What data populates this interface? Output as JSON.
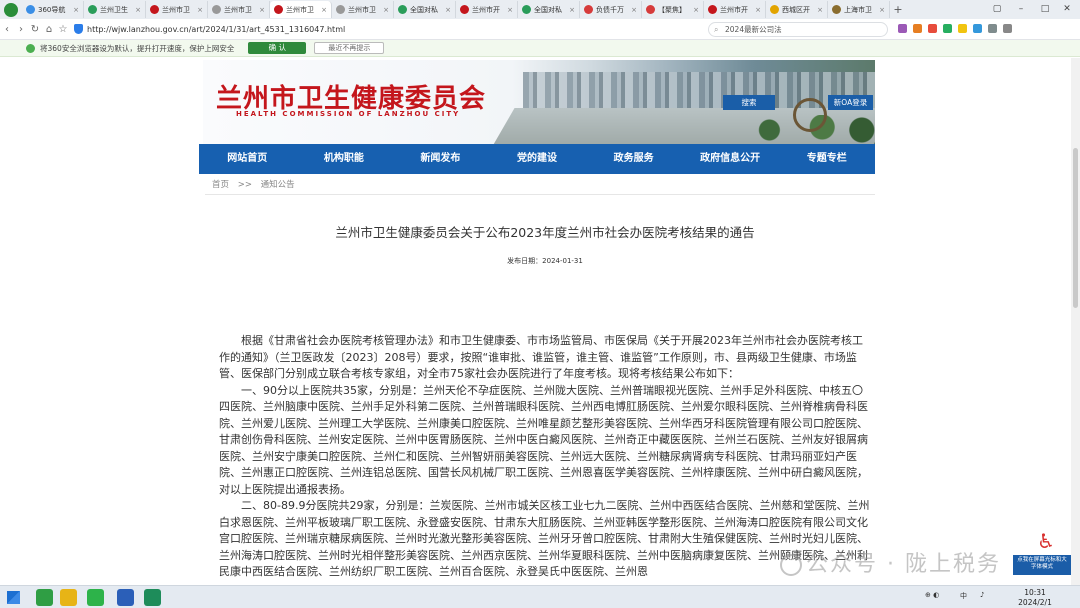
{
  "browser": {
    "tabs": [
      {
        "label": "360导航",
        "fav": "#3a8ee6"
      },
      {
        "label": "兰州卫生",
        "fav": "#2a9d5a"
      },
      {
        "label": "兰州市卫",
        "fav": "#c4161c"
      },
      {
        "label": "兰州市卫",
        "fav": "#999999"
      },
      {
        "label": "兰州市卫",
        "fav": "#c4161c",
        "active": true
      },
      {
        "label": "兰州市卫",
        "fav": "#999999"
      },
      {
        "label": "全国对私",
        "fav": "#2a9d5a"
      },
      {
        "label": "兰州市开",
        "fav": "#c4161c"
      },
      {
        "label": "全国对私",
        "fav": "#2a9d5a"
      },
      {
        "label": "负债千万",
        "fav": "#d63b3b"
      },
      {
        "label": "【聚焦】",
        "fav": "#d63b3b"
      },
      {
        "label": "兰州市开",
        "fav": "#c4161c"
      },
      {
        "label": "西城区开",
        "fav": "#e2a400"
      },
      {
        "label": "上海市卫",
        "fav": "#8a6d2f"
      }
    ],
    "url": "http://wjw.lanzhou.gov.cn/art/2024/1/31/art_4531_1316047.html",
    "search_text": "2024最新公司法",
    "notice": {
      "text": "将360安全浏览器设为默认，提升打开速度，保护上网安全",
      "ok_label": "确 认",
      "later_label": "最近不再提示"
    }
  },
  "site": {
    "title": "兰州市卫生健康委员会",
    "subtitle": "HEALTH COMMISSION OF LANZHOU CITY",
    "search_label": "搜索",
    "oa_label": "新OA登录",
    "nav": [
      "网站首页",
      "机构职能",
      "新闻发布",
      "党的建设",
      "政务服务",
      "政府信息公开",
      "专题专栏"
    ]
  },
  "breadcrumb": {
    "home": "首页",
    "sep": ">>",
    "current": "通知公告"
  },
  "article": {
    "title": "兰州市卫生健康委员会关于公布2023年度兰州市社会办医院考核结果的通告",
    "date_label": "发布日期：",
    "date": "2024-01-31",
    "paragraphs": [
      "根据《甘肃省社会办医院考核管理办法》和市卫生健康委、市市场监管局、市医保局《关于开展2023年兰州市社会办医院考核工作的通知》（兰卫医政发〔2023〕208号）要求，按照“谁审批、谁监管，谁主管、谁监管”工作原则，市、县两级卫生健康、市场监管、医保部门分别成立联合考核专家组，对全市75家社会办医院进行了年度考核。现将考核结果公布如下：",
      "一、90分以上医院共35家，分别是：兰州天伦不孕症医院、兰州陇大医院、兰州普瑞眼视光医院、兰州手足外科医院、中核五〇四医院、兰州脑康中医院、兰州手足外科第二医院、兰州普瑞眼科医院、兰州西电博肛肠医院、兰州爱尔眼科医院、兰州脊椎病骨科医院、兰州爱儿医院、兰州理工大学医院、兰州康美口腔医院、兰州唯星颜艺整形美容医院、兰州华西牙科医院管理有限公司口腔医院、甘肃创伤骨科医院、兰州安定医院、兰州中医胃肠医院、兰州中医白癜风医院、兰州奇正中藏医医院、兰州兰石医院、兰州友好银屑病医院、兰州安宁康美口腔医院、兰州仁和医院、兰州智妍丽美容医院、兰州远大医院、兰州糖尿病肾病专科医院、甘肃玛丽亚妇产医院、兰州惠正口腔医院、兰州连铝总医院、国营长风机械厂职工医院、兰州恩喜医学美容医院、兰州梓康医院、兰州中研白癜风医院，对以上医院提出通报表扬。",
      "二、80-89.9分医院共29家，分别是：兰炭医院、兰州市城关区核工业七九二医院、兰州中西医结合医院、兰州慈和堂医院、兰州白求恩医院、兰州平板玻璃厂职工医院、永登盛安医院、甘肃东大肛肠医院、兰州亚韩医学整形医院、兰州海涛口腔医院有限公司文化宫口腔医院、兰州瑞京糖尿病医院、兰州时光激光整形美容医院、兰州牙牙曾口腔医院、甘肃附大生殖保健医院、兰州时光妇儿医院、兰州海涛口腔医院、兰州时光相伴整形美容医院、兰州西京医院、兰州华夏眼科医院、兰州中医脑病康复医院、兰州颐康医院、兰州利民康中西医结合医院、兰州纺织厂职工医院、兰州百合医院、永登吴氏中医医院、兰州恩"
    ]
  },
  "accessibility": {
    "text": "点我在屏幕光标和大字体模式"
  },
  "watermark": {
    "text": "公众号 · 陇上税务"
  },
  "taskbar": {
    "time": "10:31",
    "date": "2024/2/1",
    "ime": "中"
  }
}
